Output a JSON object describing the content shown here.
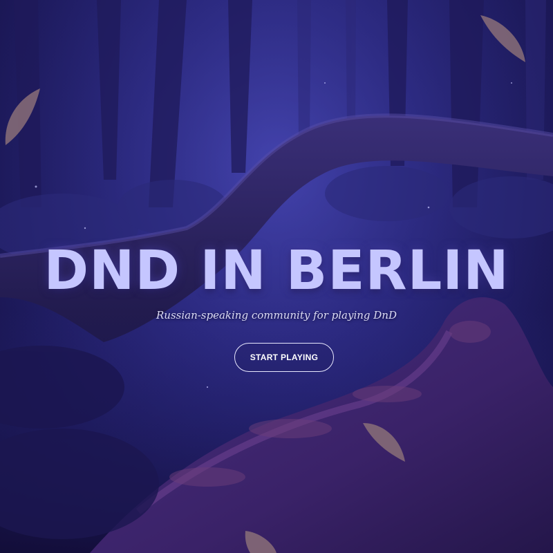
{
  "hero": {
    "title": "DND IN BERLIN",
    "subtitle": "Russian-speaking community for playing DnD",
    "cta_label": "START PLAYING"
  },
  "colors": {
    "background": "#2a2880",
    "title": "#c5c6ff",
    "subtitle": "#dcdcf4",
    "button_border": "#e9e9ff",
    "moss": "#5a3a8a"
  }
}
